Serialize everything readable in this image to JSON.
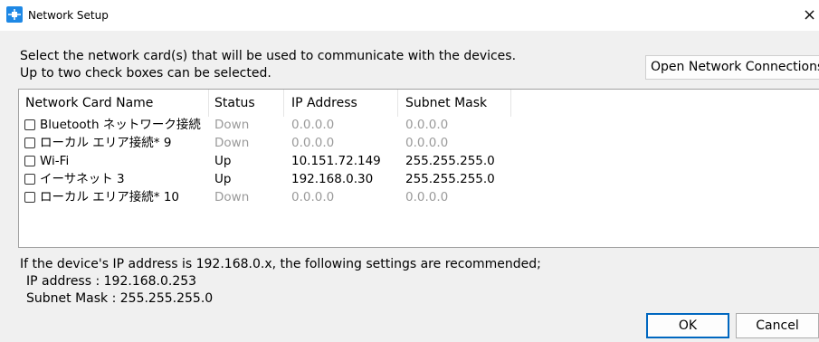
{
  "window": {
    "title": "Network Setup",
    "close_glyph": "×",
    "icon": "network-setup-icon"
  },
  "instructions": {
    "line1": "Select the network card(s) that will be used to communicate with the devices.",
    "line2": "Up to two check boxes can be selected."
  },
  "open_network_connections_label": "Open Network Connections",
  "table": {
    "headers": {
      "name": "Network Card Name",
      "status": "Status",
      "ip": "IP Address",
      "mask": "Subnet Mask"
    },
    "rows": [
      {
        "name": "Bluetooth ネットワーク接続",
        "status": "Down",
        "ip": "0.0.0.0",
        "mask": "0.0.0.0",
        "checked": false
      },
      {
        "name": "ローカル エリア接続* 9",
        "status": "Down",
        "ip": "0.0.0.0",
        "mask": "0.0.0.0",
        "checked": false
      },
      {
        "name": "Wi-Fi",
        "status": "Up",
        "ip": "10.151.72.149",
        "mask": "255.255.255.0",
        "checked": false
      },
      {
        "name": "イーサネット 3",
        "status": "Up",
        "ip": "192.168.0.30",
        "mask": "255.255.255.0",
        "checked": false
      },
      {
        "name": "ローカル エリア接続* 10",
        "status": "Down",
        "ip": "0.0.0.0",
        "mask": "0.0.0.0",
        "checked": false
      }
    ]
  },
  "recommendation": {
    "line1": "If the device's IP address is 192.168.0.x, the following settings are recommended;",
    "line2": "IP address : 192.168.0.253",
    "line3": "Subnet Mask : 255.255.255.0"
  },
  "buttons": {
    "ok": "OK",
    "cancel": "Cancel"
  },
  "colors": {
    "accent": "#0067c0",
    "disabled_text": "#9a9a9a",
    "title_icon": "#1e88e5"
  }
}
